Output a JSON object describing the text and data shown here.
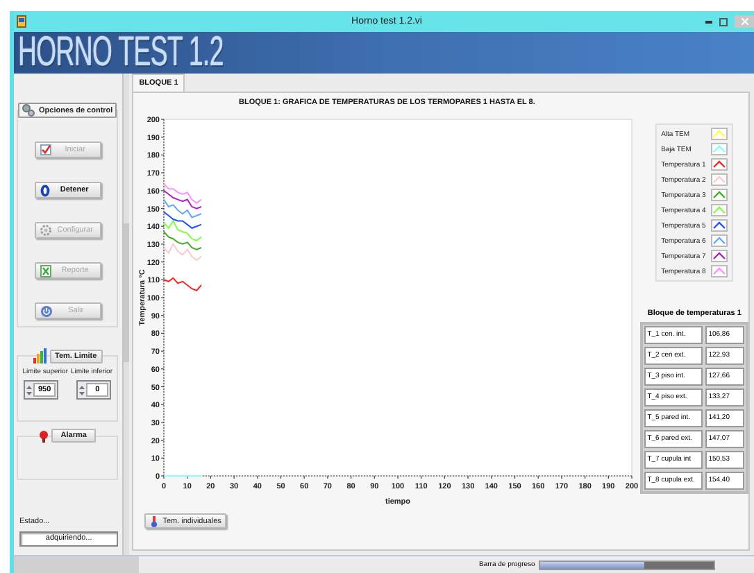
{
  "window": {
    "title": "Horno test 1.2.vi"
  },
  "banner": {
    "title": "HORNO TEST 1.2"
  },
  "control_panel": {
    "title": "Opciones de control",
    "buttons": [
      {
        "label": "Iniciar",
        "kind": "check",
        "disabled": true
      },
      {
        "label": "Detener",
        "kind": "stop",
        "disabled": false
      },
      {
        "label": "Configurar",
        "kind": "gear",
        "disabled": true
      },
      {
        "label": "Reporte",
        "kind": "sheet",
        "disabled": true
      },
      {
        "label": "Salir",
        "kind": "exit",
        "disabled": true
      }
    ]
  },
  "limits": {
    "button": "Tem. Limite",
    "upper_label": "Limite superior",
    "lower_label": "Limite inferior",
    "upper_value": "950",
    "lower_value": "0"
  },
  "alarm": {
    "button": "Alarma"
  },
  "status": {
    "label": "Estado...",
    "value": "adquiriendo..."
  },
  "tabs": [
    {
      "label": "BLOQUE 1",
      "selected": true
    }
  ],
  "chart": {
    "title": "BLOQUE 1: GRAFICA DE TEMPERATURAS DE LOS TERMOPARES 1 HASTA EL 8.",
    "chart_data": {
      "type": "line",
      "xlabel": "tiempo",
      "ylabel": "Temperatura °C",
      "x": [
        0,
        2,
        4,
        6,
        8,
        10,
        12,
        14,
        16
      ],
      "xlim": [
        0,
        200
      ],
      "ylim": [
        0,
        200
      ],
      "xticks": [
        0,
        10,
        20,
        30,
        40,
        50,
        60,
        70,
        80,
        90,
        100,
        110,
        120,
        130,
        140,
        150,
        160,
        170,
        180,
        190,
        200
      ],
      "yticks": [
        0,
        10,
        20,
        30,
        40,
        50,
        60,
        70,
        80,
        90,
        100,
        110,
        120,
        130,
        140,
        150,
        160,
        170,
        180,
        190,
        200
      ],
      "series": [
        {
          "name": "Alta TEM",
          "color": "#ffff40",
          "values": [
            null,
            null,
            null,
            null,
            null,
            null,
            null,
            null,
            null
          ]
        },
        {
          "name": "Baja TEM",
          "color": "#80ffff",
          "values": [
            0,
            0,
            0,
            0,
            0,
            0,
            0,
            0,
            0
          ]
        },
        {
          "name": "Temperatura 1",
          "color": "#ff2020",
          "values": [
            110,
            109,
            111,
            108,
            109,
            107,
            105,
            104,
            107
          ]
        },
        {
          "name": "Temperatura 2",
          "color": "#ffc8c8",
          "values": [
            128,
            125,
            130,
            126,
            124,
            127,
            123,
            121,
            123
          ]
        },
        {
          "name": "Temperatura 3",
          "color": "#40b020",
          "values": [
            137,
            134,
            133,
            131,
            130,
            131,
            128,
            127,
            128
          ]
        },
        {
          "name": "Temperatura 4",
          "color": "#80ff40",
          "values": [
            142,
            139,
            143,
            138,
            137,
            136,
            133,
            132,
            134
          ]
        },
        {
          "name": "Temperatura 5",
          "color": "#2050ff",
          "values": [
            148,
            146,
            144,
            143,
            143,
            141,
            139,
            140,
            141
          ]
        },
        {
          "name": "Temperatura 6",
          "color": "#60a8ff",
          "values": [
            155,
            151,
            152,
            149,
            147,
            149,
            145,
            146,
            147
          ]
        },
        {
          "name": "Temperatura 7",
          "color": "#b020c0",
          "values": [
            160,
            158,
            156,
            155,
            154,
            155,
            151,
            150,
            151
          ]
        },
        {
          "name": "Temperatura 8",
          "color": "#ff90ff",
          "values": [
            164,
            161,
            161,
            159,
            158,
            159,
            155,
            153,
            155
          ]
        }
      ]
    }
  },
  "individual_button": "Tem. individuales",
  "table": {
    "title": "Bloque de temperaturas 1",
    "rows": [
      {
        "label": "T_1 cen. int.",
        "value": "106,86"
      },
      {
        "label": "T_2 cen ext.",
        "value": "122,93"
      },
      {
        "label": "T_3 piso int.",
        "value": "127,66"
      },
      {
        "label": "T_4 piso ext.",
        "value": "133,27"
      },
      {
        "label": "T_5 pared int.",
        "value": "141,20"
      },
      {
        "label": "T_6 pared ext.",
        "value": "147,07"
      },
      {
        "label": "T_7 cupula int",
        "value": "150,53"
      },
      {
        "label": "T_8 cupula ext.",
        "value": "154,40"
      }
    ]
  },
  "progress": {
    "label": "Barra de progreso",
    "level": 0.6
  }
}
